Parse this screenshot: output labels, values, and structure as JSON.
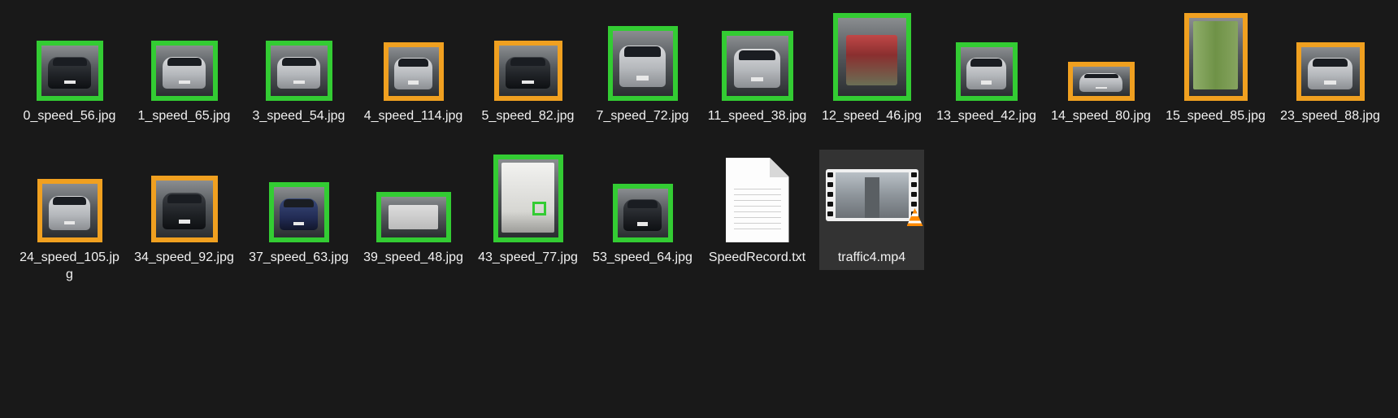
{
  "colors": {
    "background": "#191919",
    "green_box": "#33cc33",
    "orange_box": "#f0a020",
    "selected": "#333333"
  },
  "files": [
    {
      "name": "0_speed_56.jpg",
      "type": "image",
      "box": "green",
      "icon": "car-rear-thumbnail"
    },
    {
      "name": "1_speed_65.jpg",
      "type": "image",
      "box": "green",
      "icon": "car-rear-thumbnail"
    },
    {
      "name": "3_speed_54.jpg",
      "type": "image",
      "box": "green",
      "icon": "car-rear-thumbnail"
    },
    {
      "name": "4_speed_114.jpg",
      "type": "image",
      "box": "orange",
      "icon": "car-rear-thumbnail"
    },
    {
      "name": "5_speed_82.jpg",
      "type": "image",
      "box": "orange",
      "icon": "car-rear-thumbnail"
    },
    {
      "name": "7_speed_72.jpg",
      "type": "image",
      "box": "green",
      "icon": "suv-rear-thumbnail"
    },
    {
      "name": "11_speed_38.jpg",
      "type": "image",
      "box": "green",
      "icon": "suv-rear-thumbnail"
    },
    {
      "name": "12_speed_46.jpg",
      "type": "image",
      "box": "green",
      "icon": "truck-rear-thumbnail"
    },
    {
      "name": "13_speed_42.jpg",
      "type": "image",
      "box": "green",
      "icon": "car-rear-thumbnail"
    },
    {
      "name": "14_speed_80.jpg",
      "type": "image",
      "box": "orange",
      "icon": "car-rear-thumbnail"
    },
    {
      "name": "15_speed_85.jpg",
      "type": "image",
      "box": "orange",
      "icon": "box-truck-thumbnail"
    },
    {
      "name": "23_speed_88.jpg",
      "type": "image",
      "box": "orange",
      "icon": "car-rear-thumbnail"
    },
    {
      "name": "24_speed_105.jpg",
      "type": "image",
      "box": "orange",
      "icon": "car-rear-thumbnail"
    },
    {
      "name": "34_speed_92.jpg",
      "type": "image",
      "box": "orange",
      "icon": "suv-rear-thumbnail"
    },
    {
      "name": "37_speed_63.jpg",
      "type": "image",
      "box": "green",
      "icon": "car-rear-thumbnail"
    },
    {
      "name": "39_speed_48.jpg",
      "type": "image",
      "box": "green",
      "icon": "truck-rear-thumbnail"
    },
    {
      "name": "43_speed_77.jpg",
      "type": "image",
      "box": "green",
      "icon": "box-truck-thumbnail"
    },
    {
      "name": "53_speed_64.jpg",
      "type": "image",
      "box": "green",
      "icon": "suv-rear-thumbnail"
    },
    {
      "name": "SpeedRecord.txt",
      "type": "text",
      "icon": "text-document-icon"
    },
    {
      "name": "traffic4.mp4",
      "type": "video",
      "icon": "vlc-video-icon",
      "selected": true
    }
  ]
}
